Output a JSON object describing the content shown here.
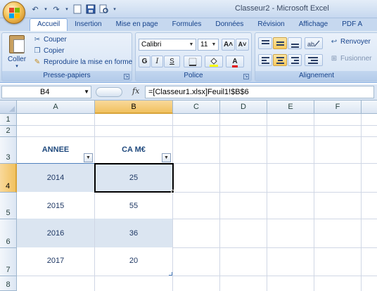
{
  "window": {
    "title": "Classeur2 - Microsoft Excel"
  },
  "quick_access": {
    "save_icon": "save-icon",
    "undo_icon": "undo-icon",
    "redo_icon": "redo-icon"
  },
  "ribbon": {
    "tabs": [
      {
        "label": "Accueil",
        "active": true
      },
      {
        "label": "Insertion"
      },
      {
        "label": "Mise en page"
      },
      {
        "label": "Formules"
      },
      {
        "label": "Données"
      },
      {
        "label": "Révision"
      },
      {
        "label": "Affichage"
      },
      {
        "label": "PDF A"
      }
    ],
    "clipboard": {
      "paste_label": "Coller",
      "cut_label": "Couper",
      "copy_label": "Copier",
      "format_painter_label": "Reproduire la mise en forme",
      "group_label": "Presse-papiers"
    },
    "font": {
      "font_name": "Calibri",
      "font_size": "11",
      "bold": "G",
      "italic": "I",
      "underline": "S",
      "grow": "A˄",
      "shrink": "A˅",
      "color_letter": "A",
      "group_label": "Police"
    },
    "alignment": {
      "wrap_label": "Renvoyer",
      "merge_label": "Fusionner",
      "group_label": "Alignement"
    }
  },
  "formula_bar": {
    "name_box": "B4",
    "fx": "fx",
    "formula": "=[Classeur1.xlsx]Feuil1!$B$6"
  },
  "sheet": {
    "columns": [
      "A",
      "B",
      "C",
      "D",
      "E",
      "F"
    ],
    "selected_column": "B",
    "rows": [
      "1",
      "2",
      "3",
      "4",
      "5",
      "6",
      "7",
      "8"
    ],
    "selected_row": "4",
    "table": {
      "headers": [
        "ANNEE",
        "CA M€"
      ],
      "rows": [
        {
          "annee": "2014",
          "ca": "25"
        },
        {
          "annee": "2015",
          "ca": "55"
        },
        {
          "annee": "2016",
          "ca": "36"
        },
        {
          "annee": "2017",
          "ca": "20"
        }
      ],
      "band_color": "#dbe5f1",
      "header_color": "#1f497d"
    }
  }
}
